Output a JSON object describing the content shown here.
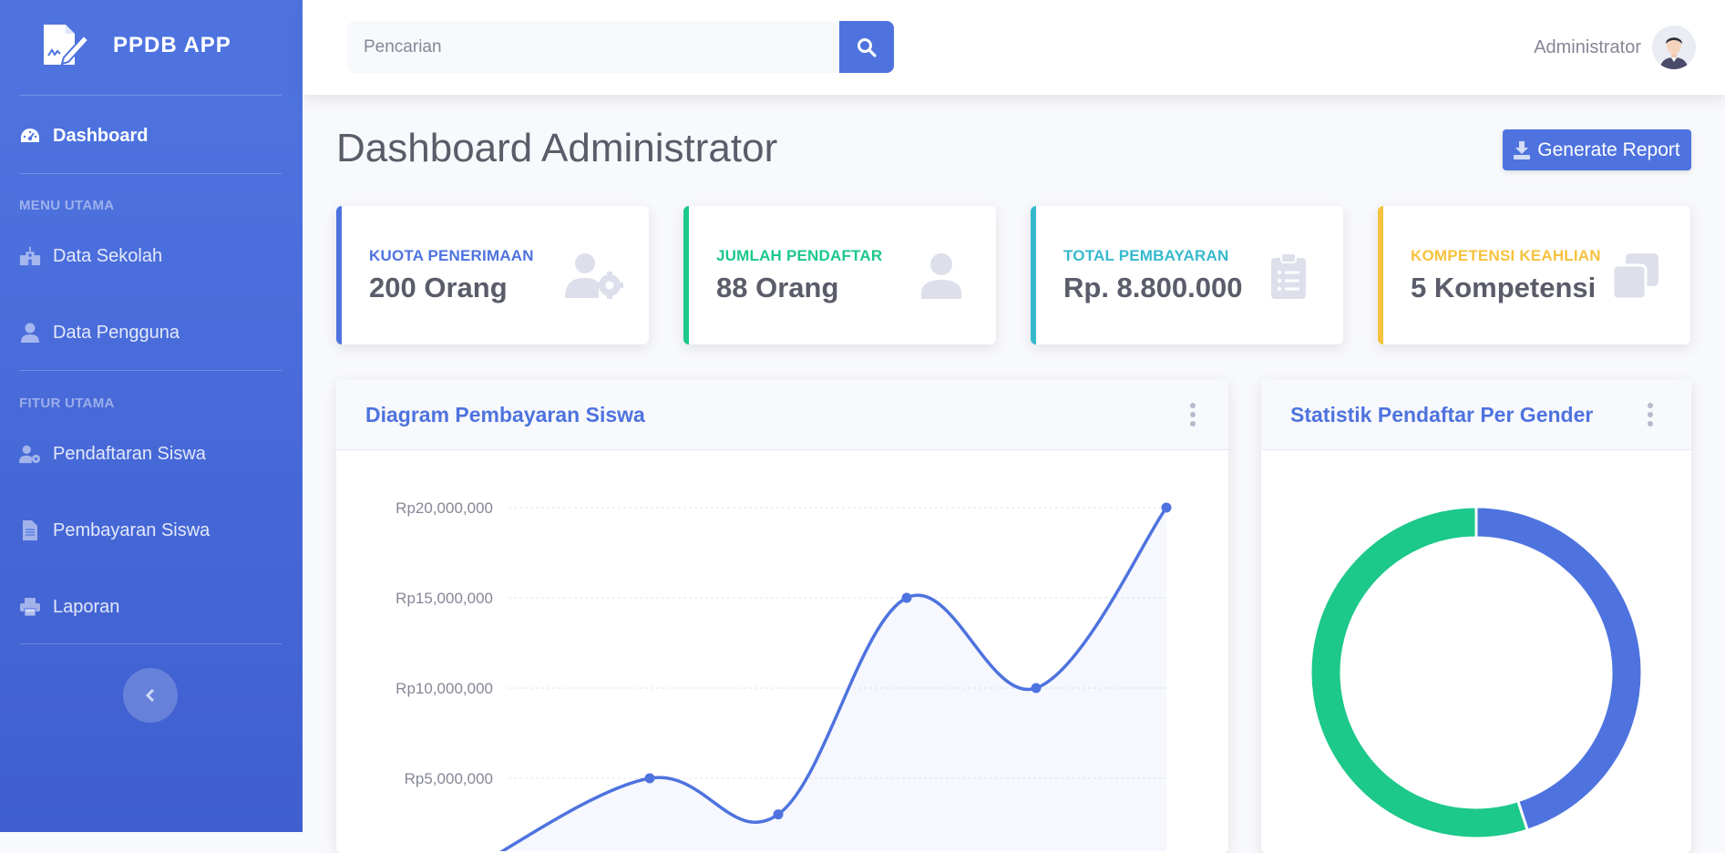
{
  "brand": {
    "name": "PPDB APP",
    "icon": "signature-document-icon"
  },
  "sidebar": {
    "dashboard": {
      "label": "Dashboard",
      "icon": "tachometer-icon"
    },
    "section_main": "MENU UTAMA",
    "section_features": "FITUR UTAMA",
    "items": [
      {
        "label": "Data Sekolah",
        "icon": "school-icon"
      },
      {
        "label": "Data Pengguna",
        "icon": "user-icon"
      },
      {
        "label": "Pendaftaran Siswa",
        "icon": "user-cog-icon"
      },
      {
        "label": "Pembayaran Siswa",
        "icon": "file-icon"
      },
      {
        "label": "Laporan",
        "icon": "print-icon"
      }
    ],
    "toggle_icon": "chevron-left-icon"
  },
  "topbar": {
    "search_placeholder": "Pencarian",
    "search_icon": "search-icon",
    "user_name": "Administrator",
    "avatar_icon": "avatar-icon"
  },
  "page": {
    "title": "Dashboard Administrator",
    "generate_label": "Generate Report",
    "generate_icon": "download-icon"
  },
  "cards": [
    {
      "title": "KUOTA PENERIMAAN",
      "value": "200 Orang",
      "color": "#4e73df",
      "icon": "user-cog-icon"
    },
    {
      "title": "JUMLAH PENDAFTAR",
      "value": "88 Orang",
      "color": "#1cc88a",
      "icon": "user-icon"
    },
    {
      "title": "TOTAL PEMBAYARAN",
      "value": "Rp. 8.800.000",
      "color": "#36b9cc",
      "icon": "clipboard-list-icon"
    },
    {
      "title": "KOMPETENSI KEAHLIAN",
      "value": "5 Kompetensi",
      "color": "#f6c23e",
      "icon": "copy-icon"
    }
  ],
  "line_panel": {
    "title": "Diagram Pembayaran Siswa"
  },
  "donut_panel": {
    "title": "Statistik Pendaftar Per Gender"
  },
  "chart_data": [
    {
      "type": "area",
      "title": "Diagram Pembayaran Siswa",
      "y_tick_labels": [
        "Rp5,000,000",
        "Rp10,000,000",
        "Rp15,000,000",
        "Rp20,000,000"
      ],
      "ylim": [
        0,
        20000000
      ],
      "x": [
        1,
        2,
        3,
        4,
        5,
        6
      ],
      "values": [
        0,
        5000000,
        3000000,
        15000000,
        10000000,
        20000000
      ],
      "grid": true,
      "color": "#4e73df"
    },
    {
      "type": "pie",
      "title": "Statistik Pendaftar Per Gender",
      "values": [
        45,
        55
      ],
      "colors": [
        "#4e73df",
        "#1cc88a"
      ]
    }
  ]
}
